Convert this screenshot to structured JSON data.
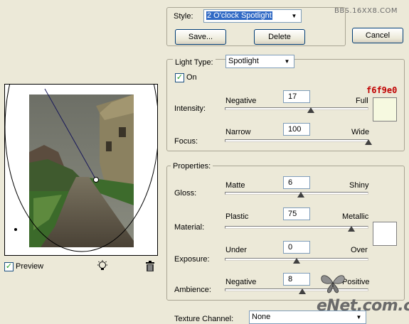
{
  "style": {
    "label": "Style:",
    "value": "2 O'clock Spotlight"
  },
  "buttons": {
    "save": "Save...",
    "delete": "Delete",
    "cancel": "Cancel"
  },
  "light": {
    "type_label": "Light Type:",
    "type_value": "Spotlight",
    "on_label": "On",
    "on_checked": true,
    "intensity": {
      "label": "Intensity:",
      "left": "Negative",
      "right": "Full",
      "value": "17",
      "level": 0.6
    },
    "focus": {
      "label": "Focus:",
      "left": "Narrow",
      "right": "Wide",
      "value": "100",
      "level": 1.0
    },
    "color_hex": "f6f9e0",
    "color": "#f6f9e0"
  },
  "properties": {
    "title": "Properties:",
    "gloss": {
      "label": "Gloss:",
      "left": "Matte",
      "right": "Shiny",
      "value": "6",
      "level": 0.53
    },
    "material": {
      "label": "Material:",
      "left": "Plastic",
      "right": "Metallic",
      "value": "75",
      "level": 0.88
    },
    "exposure": {
      "label": "Exposure:",
      "left": "Under",
      "right": "Over",
      "value": "0",
      "level": 0.5
    },
    "ambience": {
      "label": "Ambience:",
      "left": "Negative",
      "right": "Positive",
      "value": "8",
      "level": 0.54
    },
    "color": "#ffffff"
  },
  "texture": {
    "label": "Texture Channel:",
    "value": "None"
  },
  "preview": {
    "label": "Preview",
    "checked": true
  },
  "watermark": {
    "top": "BBS.16XX8.COM",
    "bottom": "eNet.com.cn"
  }
}
